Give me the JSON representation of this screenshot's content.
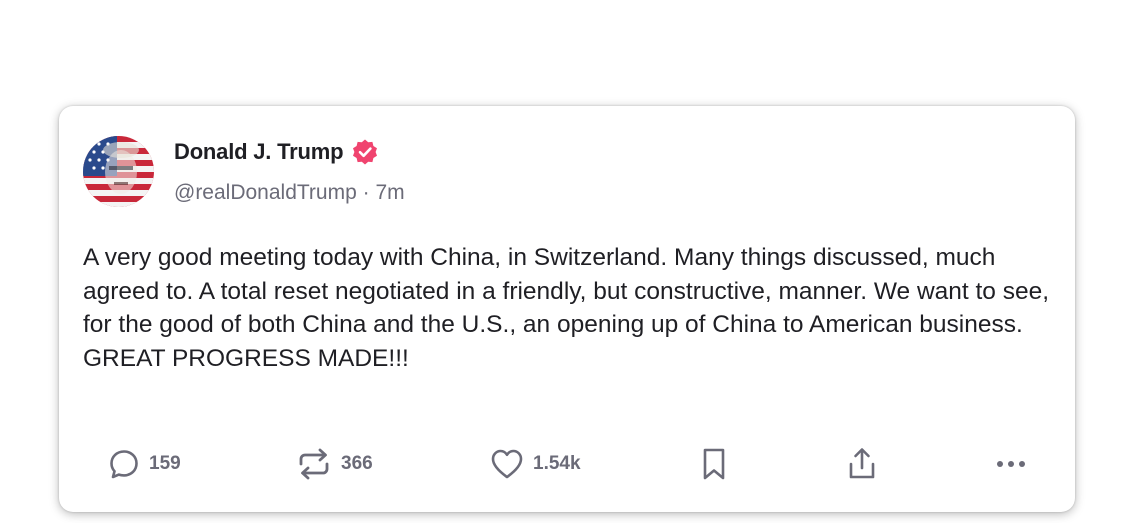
{
  "post": {
    "author": {
      "display_name": "Donald J. Trump",
      "handle": "@realDonaldTrump",
      "separator": " · ",
      "time_ago": "7m",
      "verified": true
    },
    "text": "A very good meeting today with China, in Switzerland. Many things discussed, much agreed to. A total reset negotiated in a friendly, but constructive, manner. We want to see, for the good of both China and the U.S., an opening up of China to American business. GREAT PROGRESS MADE!!!",
    "actions": {
      "reply": {
        "icon": "reply-icon",
        "count": "159"
      },
      "retruth": {
        "icon": "retruth-icon",
        "count": "366"
      },
      "like": {
        "icon": "heart-icon",
        "count": "1.54k"
      },
      "bookmark": {
        "icon": "bookmark-icon"
      },
      "share": {
        "icon": "share-icon"
      },
      "more": {
        "icon": "more-icon"
      }
    }
  },
  "colors": {
    "text_primary": "#1f1f24",
    "text_secondary": "#6b6b78",
    "verified_badge": "#f0446f",
    "card_background": "#ffffff"
  }
}
